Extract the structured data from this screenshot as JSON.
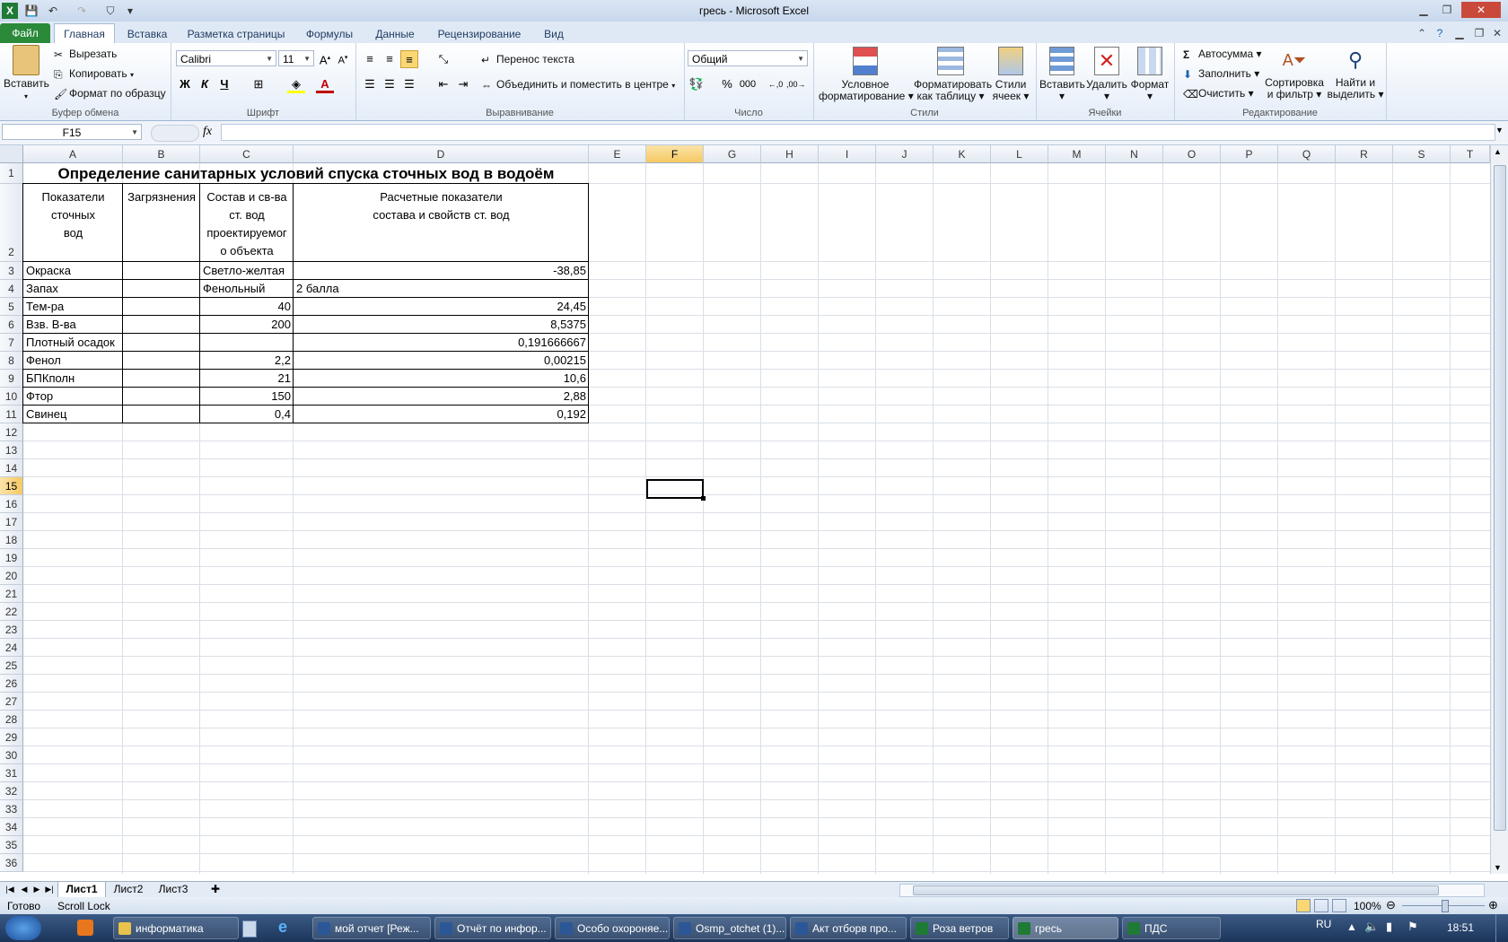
{
  "window": {
    "title": "гресь - Microsoft Excel"
  },
  "tabs": [
    "Файл",
    "Главная",
    "Вставка",
    "Разметка страницы",
    "Формулы",
    "Данные",
    "Рецензирование",
    "Вид"
  ],
  "ribbon": {
    "clipboard": {
      "paste": "Вставить",
      "cut": "Вырезать",
      "copy": "Копировать",
      "format_painter": "Формат по образцу",
      "label": "Буфер обмена"
    },
    "font": {
      "name": "Calibri",
      "size": "11",
      "bold": "Ж",
      "italic": "К",
      "underline": "Ч",
      "label": "Шрифт"
    },
    "alignment": {
      "wrap": "Перенос текста",
      "merge": "Объединить и поместить в центре",
      "label": "Выравнивание"
    },
    "number": {
      "format": "Общий",
      "percent": "%",
      "thousands": "000",
      "label": "Число"
    },
    "styles": {
      "conditional_1": "Условное",
      "conditional_2": "форматирование",
      "table_1": "Форматировать",
      "table_2": "как таблицу",
      "cell_1": "Стили",
      "cell_2": "ячеек",
      "label": "Стили"
    },
    "cells": {
      "insert": "Вставить",
      "delete": "Удалить",
      "format": "Формат",
      "label": "Ячейки"
    },
    "editing": {
      "autosum": "Автосумма",
      "fill": "Заполнить",
      "clear": "Очистить",
      "sort_1": "Сортировка",
      "sort_2": "и фильтр",
      "find_1": "Найти и",
      "find_2": "выделить",
      "label": "Редактирование"
    }
  },
  "formula_bar": {
    "name_box": "F15",
    "fx": "fx",
    "value": ""
  },
  "columns": [
    "A",
    "B",
    "C",
    "D",
    "E",
    "F",
    "G",
    "H",
    "I",
    "J",
    "K",
    "L",
    "M",
    "N",
    "O",
    "P",
    "Q",
    "R",
    "S",
    "T"
  ],
  "rows": [
    "1",
    "2",
    "3",
    "4",
    "5",
    "6",
    "7",
    "8",
    "9",
    "10",
    "11",
    "12",
    "13",
    "14",
    "15",
    "16",
    "17",
    "18",
    "19",
    "20",
    "21",
    "22",
    "23",
    "24",
    "25",
    "26",
    "27",
    "28",
    "29",
    "30",
    "31",
    "32",
    "33",
    "34",
    "35",
    "36"
  ],
  "sheet": {
    "title": "Определение санитарных условий спуска сточных вод в водоём",
    "header": {
      "a": [
        "Показатели",
        "сточных",
        "вод"
      ],
      "b": "Загрязнения",
      "c": [
        "Состав и св-ва",
        "ст. вод",
        "проектируемог",
        "о объекта"
      ],
      "d": [
        "Расчетные показатели",
        "состава и свойств ст. вод"
      ]
    },
    "data": [
      {
        "a": "Окраска",
        "c": "Светло-желтая",
        "c_num": false,
        "d": "-38,85",
        "d_num": true
      },
      {
        "a": "Запах",
        "c": "Фенольный",
        "c_num": false,
        "d": "2 балла",
        "d_num": false
      },
      {
        "a": "Тем-ра",
        "c": "40",
        "c_num": true,
        "d": "24,45",
        "d_num": true
      },
      {
        "a": "Взв. В-ва",
        "c": "200",
        "c_num": true,
        "d": "8,5375",
        "d_num": true
      },
      {
        "a": "Плотный осадок",
        "c": "",
        "c_num": true,
        "d": "0,191666667",
        "d_num": true
      },
      {
        "a": "Фенол",
        "c": "2,2",
        "c_num": true,
        "d": "0,00215",
        "d_num": true
      },
      {
        "a": "БПКполн",
        "c": "21",
        "c_num": true,
        "d": "10,6",
        "d_num": true
      },
      {
        "a": "Фтор",
        "c": "150",
        "c_num": true,
        "d": "2,88",
        "d_num": true
      },
      {
        "a": "Свинец",
        "c": "0,4",
        "c_num": true,
        "d": "0,192",
        "d_num": true
      }
    ]
  },
  "sheet_tabs": [
    "Лист1",
    "Лист2",
    "Лист3"
  ],
  "status": {
    "ready": "Готово",
    "scroll_lock": "Scroll Lock",
    "zoom": "100%"
  },
  "taskbar": {
    "items": [
      "информатика",
      "мой отчет [Реж...",
      "Отчёт по инфор...",
      "Особо охороняе...",
      "Osmp_otchet (1)...",
      "Акт отборв про...",
      "Роза ветров",
      "гресь",
      "ПДС"
    ],
    "lang": "RU",
    "time": "18:51"
  }
}
